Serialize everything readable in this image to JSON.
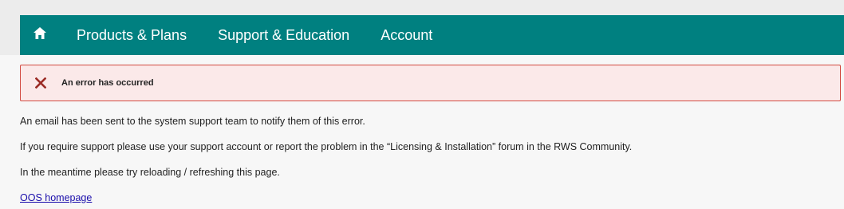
{
  "nav": {
    "home_icon": "home-icon",
    "items": [
      {
        "label": "Products & Plans"
      },
      {
        "label": "Support & Education"
      },
      {
        "label": "Account"
      }
    ]
  },
  "error": {
    "icon": "close-icon",
    "message": "An error has occurred"
  },
  "body": {
    "line1": "An email has been sent to the system support team to notify them of this error.",
    "line2": "If you require support please use your support account or report the problem in the “Licensing & Installation” forum in the RWS Community.",
    "line3": "In the meantime please try reloading / refreshing this page.",
    "link": "OOS homepage"
  },
  "colors": {
    "nav_bg": "#008080",
    "error_bg": "#fbe9e9",
    "error_border": "#d24a41",
    "error_icon": "#9b2b25",
    "link": "#1a0dab"
  }
}
